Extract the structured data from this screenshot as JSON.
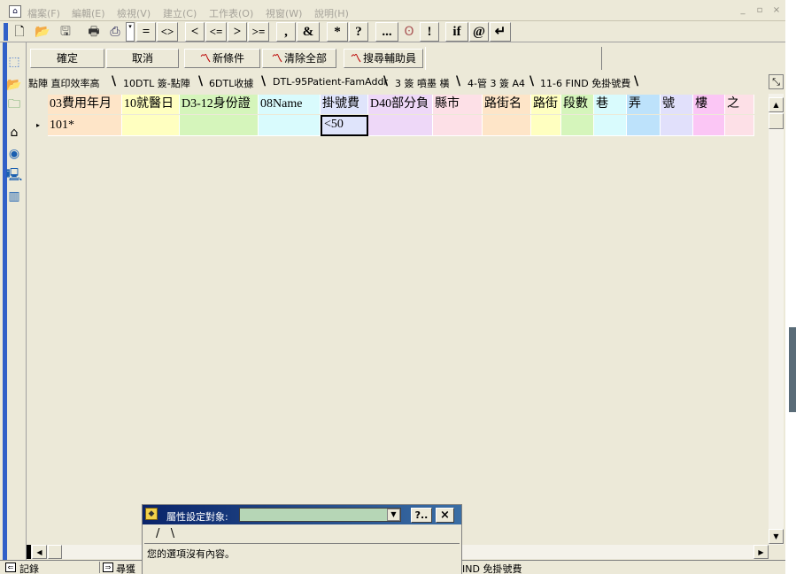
{
  "menu": [
    "檔案(F)",
    "編輯(E)",
    "檢視(V)",
    "建立(C)",
    "工作表(O)",
    "視窗(W)",
    "說明(H)"
  ],
  "window_controls": [
    "_",
    "▫",
    "×"
  ],
  "toolbar": {
    "ops": [
      "=",
      "<>",
      "<",
      "<=",
      ">",
      ">=",
      ",",
      "&",
      "*",
      "?",
      "...",
      "!",
      "if",
      "@",
      "↵"
    ]
  },
  "query_bar": {
    "ok_label": "確定",
    "cancel_label": "取消",
    "new_condition_label": "新條件",
    "clear_all_label": "清除全部",
    "search_helper_label": "搜尋輔助員"
  },
  "tabs": [
    "點陣 直印效率高",
    "10DTL 簽-點陣",
    "6DTL收據",
    "DTL-95Patient-FamAddr",
    "3 簽 噴墨 橫",
    "4-管 3 簽 A4",
    "11-6 FIND 免掛號費"
  ],
  "columns": [
    {
      "label": "03費用年月",
      "color": "#fee5c8"
    },
    {
      "label": "10就醫日",
      "color": "#ffffc0"
    },
    {
      "label": "D3-12身份證",
      "color": "#d5f5bb"
    },
    {
      "label": "08Name",
      "color": "#d9fbfd"
    },
    {
      "label": "掛號費",
      "color": "#dfe4fb"
    },
    {
      "label": "D40部分負",
      "color": "#eed8f8"
    },
    {
      "label": "縣市",
      "color": "#fde0e7"
    },
    {
      "label": "路街名",
      "color": "#fee5c8"
    },
    {
      "label": "路街",
      "color": "#ffffc0"
    },
    {
      "label": "段數",
      "color": "#d5f5bb"
    },
    {
      "label": "巷",
      "color": "#d9fbfd"
    },
    {
      "label": "弄",
      "color": "#bde2fb"
    },
    {
      "label": "號",
      "color": "#e1e0fb"
    },
    {
      "label": "樓",
      "color": "#fbc6f5"
    },
    {
      "label": "之",
      "color": "#fde0e7"
    }
  ],
  "row": [
    "101*",
    "",
    "",
    "",
    "<50",
    "",
    "",
    "",
    "",
    "",
    "",
    "",
    "",
    "",
    ""
  ],
  "property_panel": {
    "title": "屬性設定對象:",
    "help_label": "?..",
    "close_label": "×",
    "message": "您的選項沒有內容。"
  },
  "status": {
    "records_label": "記錄",
    "search_label": "尋獲",
    "tab_name": "IND 免掛號費"
  }
}
